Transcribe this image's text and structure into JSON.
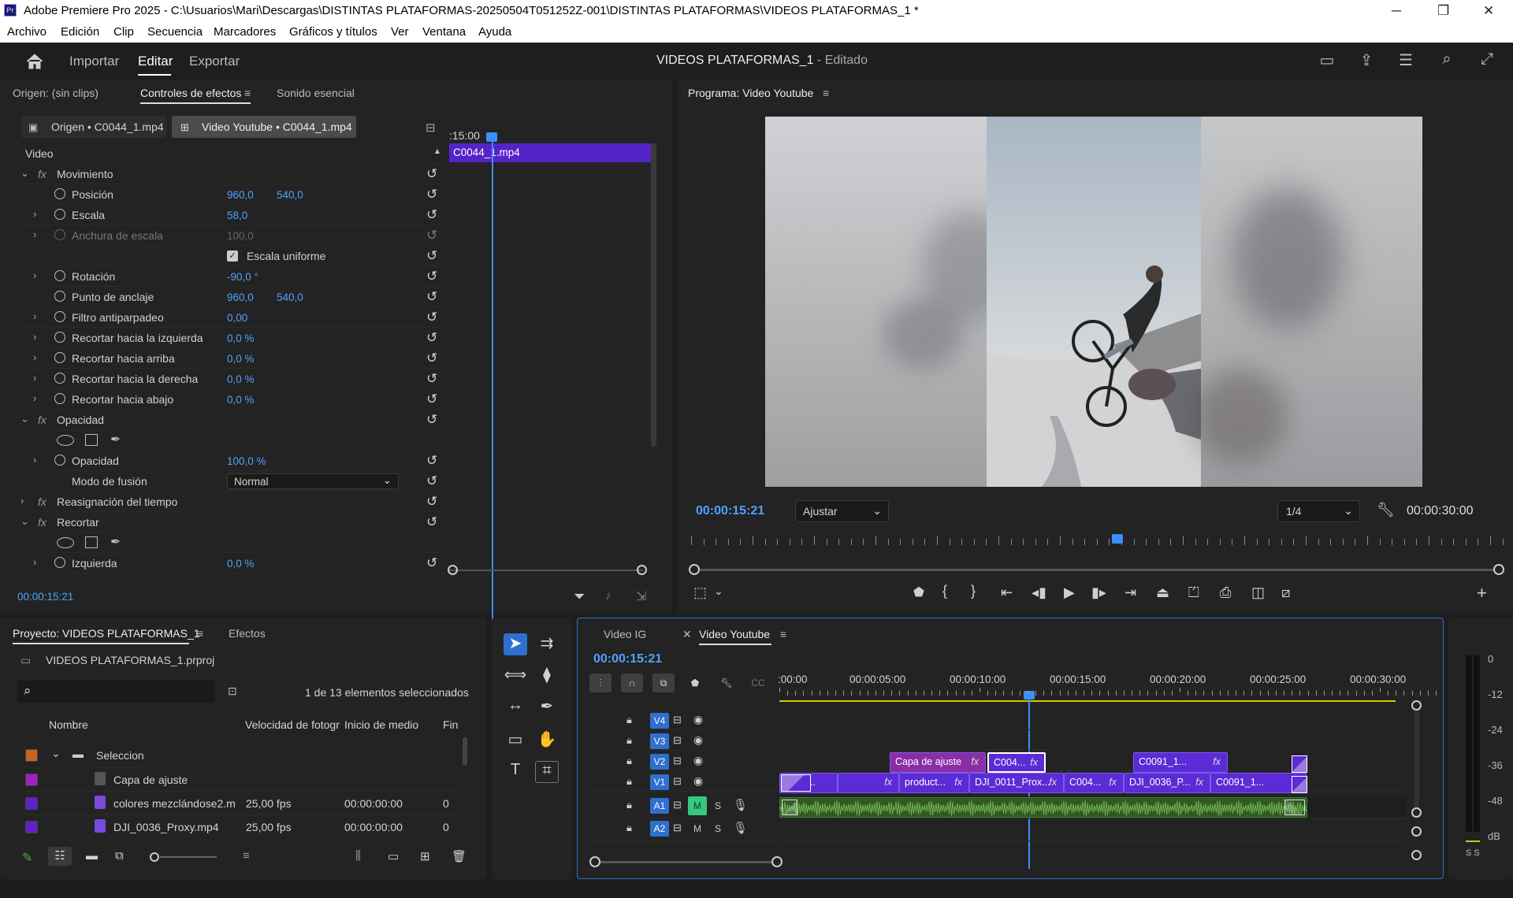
{
  "window": {
    "title": "Adobe Premiere Pro 2025 - C:\\Usuarios\\Mari\\Descargas\\DISTINTAS PLATAFORMAS-20250504T051252Z-001\\DISTINTAS PLATAFORMAS\\VIDEOS PLATAFORMAS_1 *",
    "app_icon": "Pr",
    "minimize": "─",
    "maximize": "❐",
    "close": "✕"
  },
  "menu": [
    "Archivo",
    "Edición",
    "Clip",
    "Secuencia",
    "Marcadores",
    "Gráficos y títulos",
    "Ver",
    "Ventana",
    "Ayuda"
  ],
  "header": {
    "home_icon": "home-icon",
    "nav": [
      "Importar",
      "Editar",
      "Exportar"
    ],
    "active_nav": "Editar",
    "doc_title": "VIDEOS PLATAFORMAS_1",
    "doc_status": "- Editado"
  },
  "effects_panel": {
    "tabs": [
      "Origen: (sin clips)",
      "Controles de efectos",
      "Sonido esencial"
    ],
    "source_clip": "Origen • C0044_1.mp4",
    "sequence_clip": "Video Youtube • C0044_1.mp4",
    "section": "Video",
    "timeline_time": ":15:00",
    "timeline_clip": "C0044_1.mp4",
    "rows": [
      {
        "label": "Movimiento",
        "fx": true,
        "expanded": true
      },
      {
        "label": "Posición",
        "v1": "960,0",
        "v2": "540,0",
        "stopwatch": true
      },
      {
        "label": "Escala",
        "v1": "58,0",
        "expand": true,
        "stopwatch": true
      },
      {
        "label": "Anchura de escala",
        "v1": "100,0",
        "expand": true,
        "stopwatch": true,
        "disabled": true
      },
      {
        "label": "Escala uniforme",
        "checkbox": true
      },
      {
        "label": "Rotación",
        "v1": "-90,0 °",
        "expand": true,
        "stopwatch": true
      },
      {
        "label": "Punto de anclaje",
        "v1": "960,0",
        "v2": "540,0",
        "stopwatch": true
      },
      {
        "label": "Filtro antiparpadeo",
        "v1": "0,00",
        "expand": true,
        "stopwatch": true
      },
      {
        "label": "Recortar hacia la izquierda",
        "v1": "0,0 %",
        "expand": true,
        "stopwatch": true
      },
      {
        "label": "Recortar hacia arriba",
        "v1": "0,0 %",
        "expand": true,
        "stopwatch": true
      },
      {
        "label": "Recortar hacia la derecha",
        "v1": "0,0 %",
        "expand": true,
        "stopwatch": true
      },
      {
        "label": "Recortar hacia abajo",
        "v1": "0,0 %",
        "expand": true,
        "stopwatch": true
      },
      {
        "label": "Opacidad",
        "fx": true,
        "expanded": true
      },
      {
        "label": "",
        "shapes": true
      },
      {
        "label": "Opacidad",
        "v1": "100,0 %",
        "expand": true,
        "stopwatch": true
      },
      {
        "label": "Modo de fusión",
        "dropdown": "Normal"
      },
      {
        "label": "Reasignación del tiempo",
        "fx": true,
        "expanded": false
      },
      {
        "label": "Recortar",
        "fx": true,
        "expanded": true
      },
      {
        "label": "",
        "shapes": true
      },
      {
        "label": "Izquierda",
        "v1": "0,0 %",
        "expand": true,
        "stopwatch": true
      }
    ],
    "current_time": "00:00:15:21"
  },
  "program_monitor": {
    "title": "Programa: Video Youtube",
    "timecode": "00:00:15:21",
    "fit": "Ajustar",
    "resolution": "1/4",
    "duration": "00:00:30:00",
    "playhead_position": 0.525
  },
  "project_panel": {
    "tabs": [
      "Proyecto: VIDEOS PLATAFORMAS_1",
      "Efectos"
    ],
    "project_file": "VIDEOS PLATAFORMAS_1.prproj",
    "selection_count": "1 de 13 elementos seleccionados",
    "columns": [
      "Nombre",
      "Velocidad de fotogr",
      "Inicio de medio",
      "Fin"
    ],
    "rows": [
      {
        "name": "Seleccion",
        "color": "#c8641e",
        "type": "folder",
        "fps": "",
        "start": "",
        "end": ""
      },
      {
        "name": "Capa de ajuste",
        "color": "#a020c0",
        "type": "adjust",
        "fps": "",
        "start": "",
        "end": ""
      },
      {
        "name": "colores mezclándose2.m",
        "color": "#6020d0",
        "type": "clip",
        "fps": "25,00 fps",
        "start": "00:00:00:00",
        "end": "0"
      },
      {
        "name": "DJI_0036_Proxy.mp4",
        "color": "#6020d0",
        "type": "clip",
        "fps": "25,00 fps",
        "start": "00:00:00:00",
        "end": "0"
      }
    ]
  },
  "timeline": {
    "tabs": [
      "Video IG",
      "Video Youtube"
    ],
    "active_tab": "Video Youtube",
    "timecode": "00:00:15:21",
    "ruler": [
      ":00:00",
      "00:00:05:00",
      "00:00:10:00",
      "00:00:15:00",
      "00:00:20:00",
      "00:00:25:00",
      "00:00:30:00"
    ],
    "video_tracks": [
      "V4",
      "V3",
      "V2",
      "V1"
    ],
    "audio_tracks": [
      "A1",
      "A2"
    ],
    "mute_label": "M",
    "solo_label": "S",
    "v2_clips": [
      {
        "name": "Capa de ajuste",
        "fx": "fx",
        "color": "#8a2ea6"
      },
      {
        "name": "C004...",
        "fx": "fx",
        "color": "#5b2bd6"
      },
      {
        "name": "C0091_1...",
        "fx": "fx",
        "color": "#5b2bd6"
      }
    ],
    "v1_clips": [
      {
        "name": "Pasa...",
        "fx": "",
        "color": "#5b2bd6"
      },
      {
        "name": "",
        "fx": "fx",
        "color": "#5b2bd6"
      },
      {
        "name": "product...",
        "fx": "fx",
        "color": "#5b2bd6"
      },
      {
        "name": "DJI_0011_Prox...",
        "fx": "fx",
        "color": "#5b2bd6"
      },
      {
        "name": "C004...",
        "fx": "fx",
        "color": "#5b2bd6"
      },
      {
        "name": "DJI_0036_P...",
        "fx": "fx",
        "color": "#5b2bd6"
      },
      {
        "name": "C0091_1...",
        "fx": "fx",
        "color": "#5b2bd6"
      }
    ]
  },
  "audio_meter": {
    "labels": [
      "0",
      "-12",
      "-24",
      "-36",
      "-48",
      "dB"
    ],
    "solo_label": "S S"
  },
  "colors": {
    "accent": "#4ea3ff",
    "clip_purple": "#5b2bd6",
    "adjust_purple": "#8a2ea6",
    "audio_green": "#4a7a3a",
    "playhead": "#3d8eff"
  }
}
